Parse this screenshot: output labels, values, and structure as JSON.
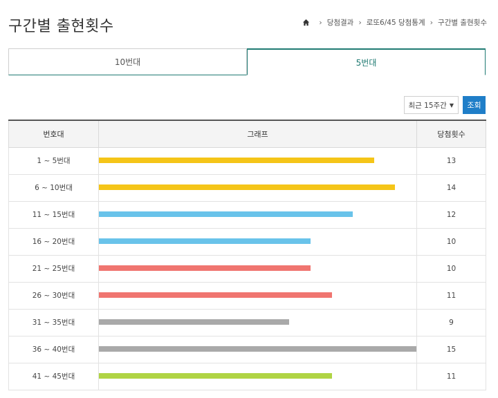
{
  "header": {
    "title": "구간별 출현횟수",
    "breadcrumb": [
      "당첨결과",
      "로또6/45 당첨통계",
      "구간별 출현횟수"
    ]
  },
  "tabs": [
    {
      "label": "10번대",
      "active": false
    },
    {
      "label": "5번대",
      "active": true
    }
  ],
  "filter": {
    "period": "최근 15주간",
    "search_label": "조회"
  },
  "table": {
    "headers": [
      "번호대",
      "그래프",
      "당첨횟수"
    ],
    "max_value": 15
  },
  "chart_data": {
    "type": "bar",
    "categories": [
      "1 ~ 5번대",
      "6 ~ 10번대",
      "11 ~ 15번대",
      "16 ~ 20번대",
      "21 ~ 25번대",
      "26 ~ 30번대",
      "31 ~ 35번대",
      "36 ~ 40번대",
      "41 ~ 45번대"
    ],
    "values": [
      13,
      14,
      12,
      10,
      10,
      11,
      9,
      15,
      11
    ],
    "colors": [
      "#f5c518",
      "#f5c518",
      "#69c3ea",
      "#69c3ea",
      "#f07570",
      "#f07570",
      "#a9a9a9",
      "#a9a9a9",
      "#b0d444"
    ],
    "xlim": [
      0,
      15
    ]
  }
}
